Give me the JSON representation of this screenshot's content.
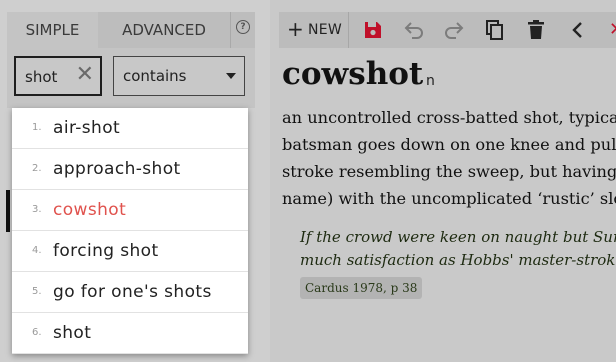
{
  "tabs": {
    "simple": "SIMPLE",
    "advanced": "ADVANCED"
  },
  "search": {
    "value": "shot",
    "match_mode": "contains"
  },
  "results": [
    {
      "num": "1.",
      "label": "air-shot"
    },
    {
      "num": "2.",
      "label": "approach-shot"
    },
    {
      "num": "3.",
      "label": "cowshot",
      "active": true
    },
    {
      "num": "4.",
      "label": "forcing shot"
    },
    {
      "num": "5.",
      "label": "go for one's shots"
    },
    {
      "num": "6.",
      "label": "shot"
    }
  ],
  "toolbar": {
    "new_label": "NEW",
    "icons": [
      "save-icon",
      "undo-icon",
      "redo-icon",
      "copy-icon",
      "delete-icon",
      "back-icon"
    ]
  },
  "entry": {
    "headword": "cowshot",
    "pos": "n",
    "definition_lines": [
      "an uncontrolled cross-batted shot, typically",
      "batsman goes down on one knee and pulls",
      "stroke resembling the sweep, but having a",
      "name) with the uncomplicated ‘rustic’ slog"
    ],
    "quote_lines": [
      "If the crowd were keen on naught but Surrey",
      "much satisfaction as Hobbs' master-stroke"
    ],
    "citation": "Cardus 1978, p 38"
  },
  "colors": {
    "active_result": "#e0524d",
    "save_icon": "#c0102a",
    "background": "#cfcfcf"
  }
}
